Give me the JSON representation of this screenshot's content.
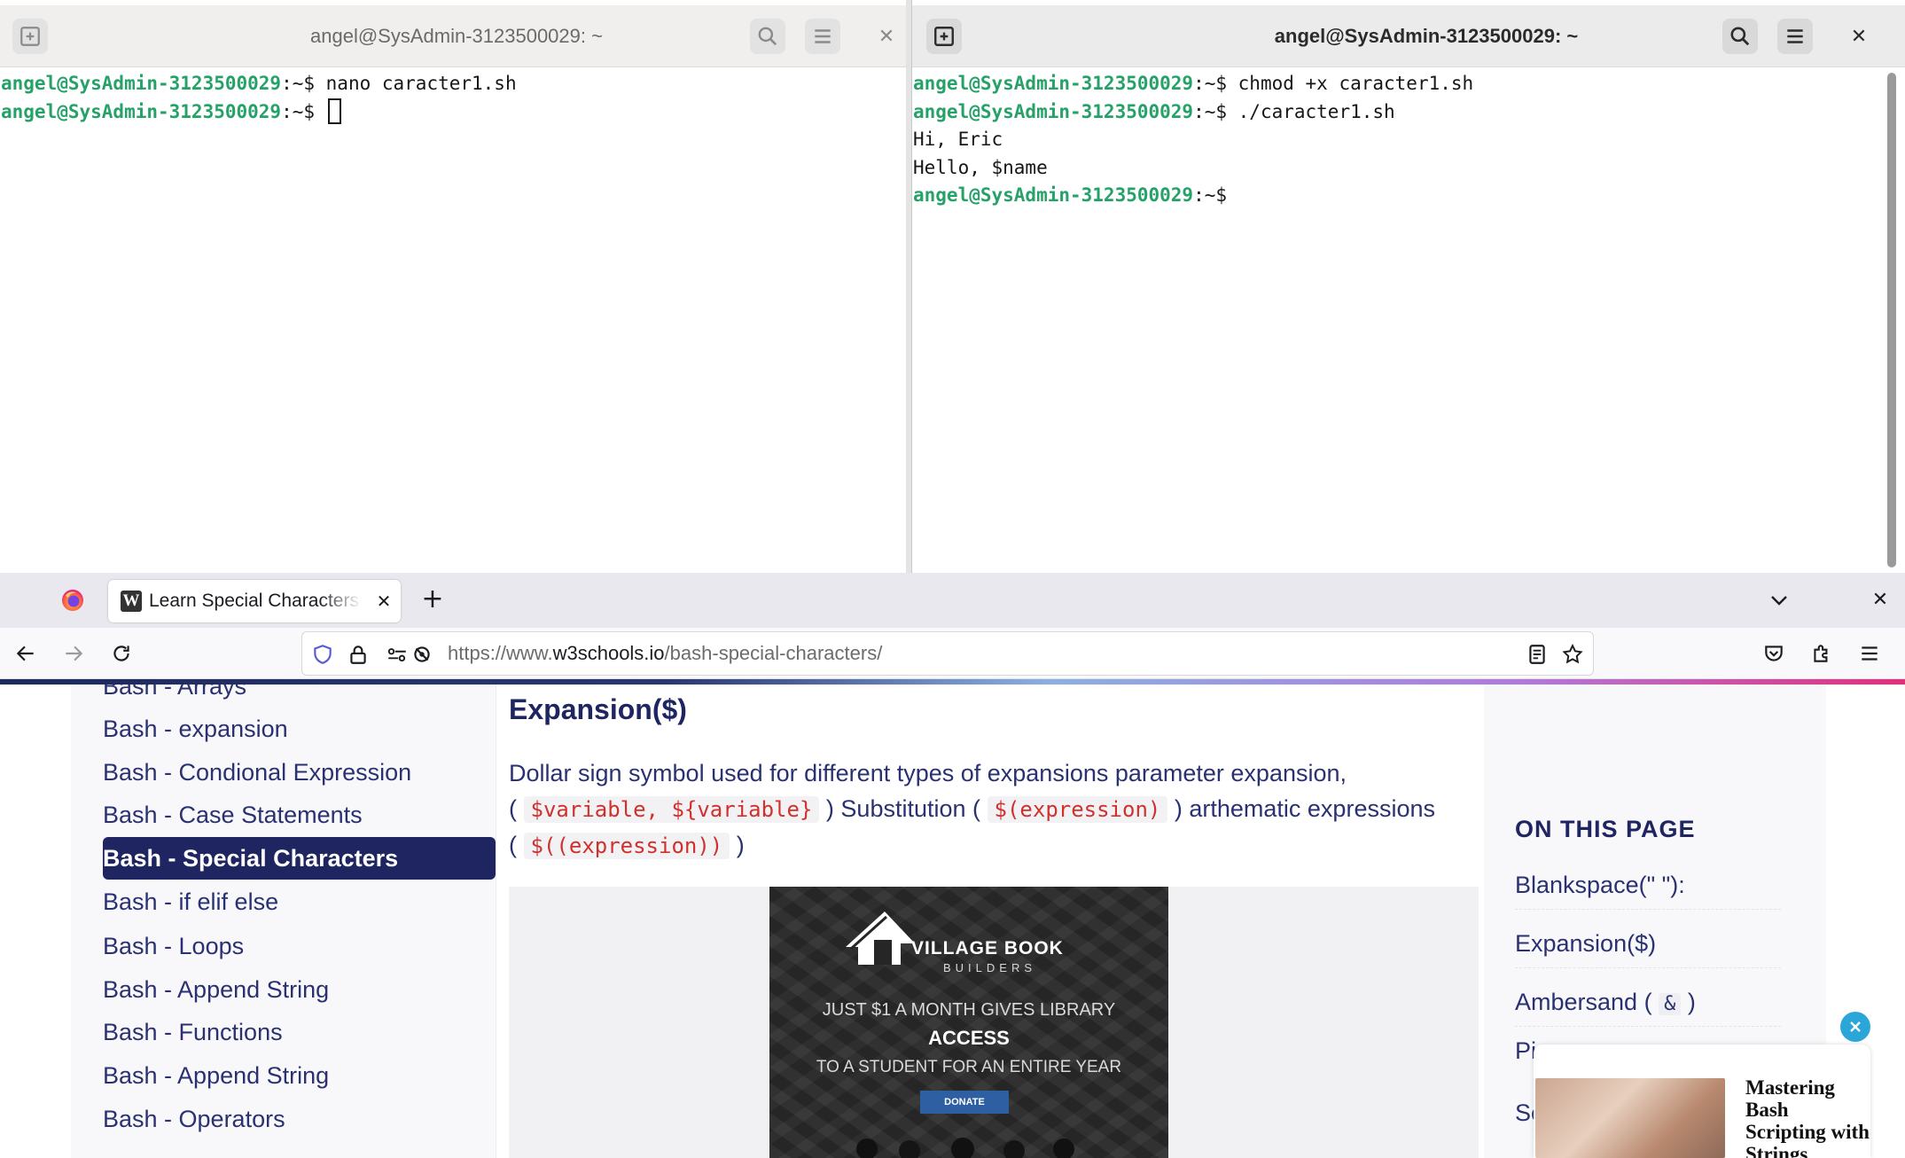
{
  "terminal_left": {
    "title": "angel@SysAdmin-3123500029: ~",
    "lines": [
      {
        "prompt": "angel@SysAdmin-3123500029",
        "suffix": ":~$ ",
        "command": "nano caracter1.sh"
      },
      {
        "prompt": "angel@SysAdmin-3123500029",
        "suffix": ":~$ ",
        "command": ""
      }
    ]
  },
  "terminal_right": {
    "title": "angel@SysAdmin-3123500029: ~",
    "lines": [
      {
        "prompt": "angel@SysAdmin-3123500029",
        "suffix": ":~$ ",
        "command": "chmod +x caracter1.sh"
      },
      {
        "prompt": "angel@SysAdmin-3123500029",
        "suffix": ":~$ ",
        "command": "./caracter1.sh"
      }
    ],
    "output": [
      "Hi, Eric",
      "Hello, $name"
    ],
    "last_prompt": {
      "prompt": "angel@SysAdmin-3123500029",
      "suffix": ":~$"
    }
  },
  "browser": {
    "tab_title": "Learn Special Characters in Bash",
    "tab_favicon": "W",
    "url_prefix": "https://www.",
    "url_domain": "w3schools.io",
    "url_path": "/bash-special-characters/"
  },
  "sidebar": {
    "items": [
      "Bash - Arrays",
      "Bash - expansion",
      "Bash - Condional Expression",
      "Bash - Case Statements",
      "Bash - Special Characters",
      "Bash - if elif else",
      "Bash - Loops",
      "Bash - Append String",
      "Bash - Functions",
      "Bash - Append String",
      "Bash - Operators"
    ],
    "active_index": 4
  },
  "content": {
    "heading": "Expansion($)",
    "p_text1": "Dollar sign symbol used for different types of expansions parameter expansion,",
    "p_paren_open": "(",
    "p_code1": "$variable, ${variable}",
    "p_text2": ") Substitution (",
    "p_code2": "$(expression)",
    "p_text3": ") arthematic expressions",
    "p_paren_open2": "(",
    "p_code3": "$((expression))",
    "p_paren_close": ")"
  },
  "ad": {
    "brand": "VILLAGE BOOK",
    "brand_sub": "BUILDERS",
    "line1": "JUST $1 A MONTH GIVES LIBRARY",
    "line2": "ACCESS",
    "line3": "TO A STUDENT FOR AN ENTIRE YEAR",
    "button": "DONATE"
  },
  "toc": {
    "heading": "ON THIS PAGE",
    "item1": "Blankspace(\" \"):",
    "item2": "Expansion($)",
    "item3_text": "Ambersand (",
    "item3_code": "&",
    "item3_close": ")",
    "partial1": "Pi",
    "partial2": "Se"
  },
  "popup": {
    "title": "Mastering Bash Scripting with Strings"
  },
  "colors": {
    "prompt_green": "#26a269",
    "sidebar_active": "#1e2561",
    "link_blue": "#2a3172",
    "code_red": "#d0312d"
  }
}
